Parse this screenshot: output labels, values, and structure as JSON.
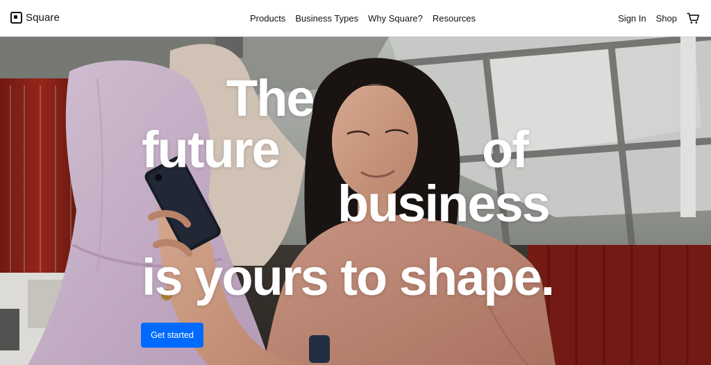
{
  "brand": {
    "name": "Square",
    "logo_icon": "square-logo-icon"
  },
  "nav": {
    "links": [
      "Products",
      "Business Types",
      "Why Square?",
      "Resources"
    ],
    "sign_in": "Sign In",
    "shop": "Shop",
    "cart_icon": "cart-icon"
  },
  "hero": {
    "headline": {
      "line1": "The",
      "line2a": "future",
      "line2b": "of",
      "line3": "business",
      "line4": "is yours to shape."
    },
    "cta_label": "Get started",
    "colors": {
      "cta": "#006aff",
      "text": "#ffffff"
    }
  }
}
